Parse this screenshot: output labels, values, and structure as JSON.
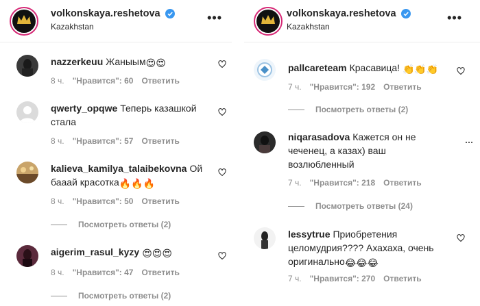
{
  "left": {
    "header": {
      "username": "volkonskaya.reshetova",
      "location": "Kazakhstan"
    },
    "comments": [
      {
        "user": "nazzerkeuu",
        "text": "Жаныым",
        "time": "8 ч.",
        "likes": "\"Нравится\": 60",
        "reply": "Ответить"
      },
      {
        "user": "qwerty_opqwe",
        "text": "Теперь казашкой стала",
        "time": "8 ч.",
        "likes": "\"Нравится\": 57",
        "reply": "Ответить"
      },
      {
        "user": "kalieva_kamilya_talaibekovna",
        "text": "Ой бааай красотка",
        "time": "8 ч.",
        "likes": "\"Нравится\": 50",
        "reply": "Ответить",
        "view_replies": "Посмотреть ответы (2)"
      },
      {
        "user": "aigerim_rasul_kyzy",
        "text": "",
        "time": "8 ч.",
        "likes": "\"Нравится\": 47",
        "reply": "Ответить",
        "view_replies": "Посмотреть ответы (2)"
      }
    ]
  },
  "right": {
    "header": {
      "username": "volkonskaya.reshetova",
      "location": "Kazakhstan"
    },
    "comments": [
      {
        "user": "pallcareteam",
        "text": "Красавица!",
        "time": "7 ч.",
        "likes": "\"Нравится\": 192",
        "reply": "Ответить",
        "view_replies": "Посмотреть ответы (2)"
      },
      {
        "user": "niqarasadova",
        "text": "Кажется он не чеченец, а казах) ваш возлюбленный",
        "time": "7 ч.",
        "likes": "\"Нравится\": 218",
        "reply": "Ответить",
        "view_replies": "Посмотреть ответы (24)"
      },
      {
        "user": "lessytrue",
        "text": "Приобретения целомудрия???? Ахахаха, очень оригинально",
        "time": "7 ч.",
        "likes": "\"Нравится\": 270",
        "reply": "Ответить"
      }
    ]
  },
  "colors": {
    "text": "#262626",
    "muted": "#8e8e8e",
    "verified": "#3897f0",
    "avatar_gold": "#e2b53a"
  }
}
